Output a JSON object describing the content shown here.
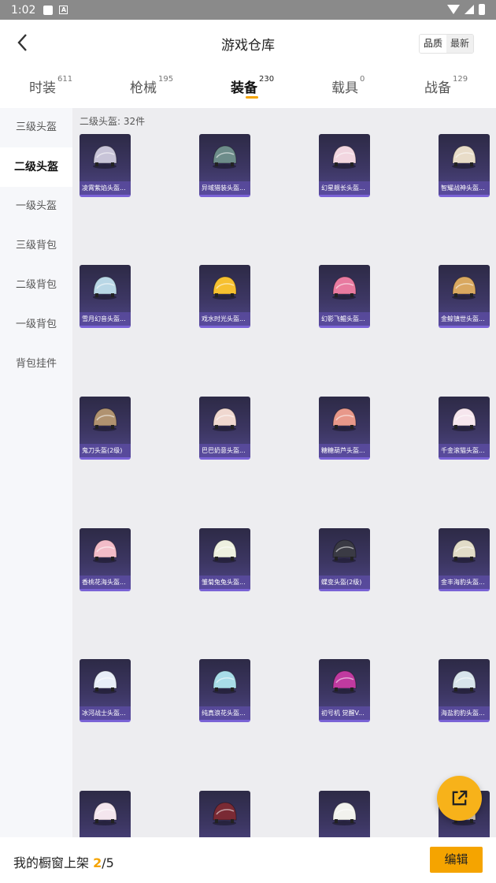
{
  "status_bar": {
    "time": "1:02"
  },
  "header": {
    "title": "游戏仓库",
    "sort_quality": "品质",
    "sort_latest": "最新"
  },
  "tabs": [
    {
      "label": "时装",
      "count": "611"
    },
    {
      "label": "枪械",
      "count": "195"
    },
    {
      "label": "装备",
      "count": "230"
    },
    {
      "label": "载具",
      "count": "0"
    },
    {
      "label": "战备",
      "count": "129"
    }
  ],
  "sidebar": {
    "items": [
      {
        "label": "三级头盔"
      },
      {
        "label": "二级头盔"
      },
      {
        "label": "一级头盔"
      },
      {
        "label": "三级背包"
      },
      {
        "label": "二级背包"
      },
      {
        "label": "一级背包"
      },
      {
        "label": "背包挂件"
      }
    ]
  },
  "main": {
    "count_label": "二级头盔: 32件",
    "items": [
      {
        "label": "凌霄紫焰头盔...",
        "color": "#c8c4d8"
      },
      {
        "label": "异域猎装头盔...",
        "color": "#6d8c8a"
      },
      {
        "label": "幻星舰长头盔...",
        "color": "#f2d6e0"
      },
      {
        "label": "智耀战神头盔...",
        "color": "#e8dcc8"
      },
      {
        "label": "雪月幻音头盔...",
        "color": "#b9d7e6"
      },
      {
        "label": "戏水时光头盔...",
        "color": "#f6c030"
      },
      {
        "label": "幻影飞鲲头盔...",
        "color": "#e87aa0"
      },
      {
        "label": "金鲸镇世头盔...",
        "color": "#d9a860"
      },
      {
        "label": "鬼刀头盔(2级)",
        "color": "#b09270"
      },
      {
        "label": "巴巴奶意头盔...",
        "color": "#f0d8d0"
      },
      {
        "label": "糖糖葫芦头盔...",
        "color": "#e8988a"
      },
      {
        "label": "千金滚猫头盔...",
        "color": "#f6e6ee"
      },
      {
        "label": "香桃花海头盔...",
        "color": "#f2bcc8"
      },
      {
        "label": "雏菊兔兔头盔...",
        "color": "#eef0e0"
      },
      {
        "label": "蝶变头盔(2级)",
        "color": "#3a3a44"
      },
      {
        "label": "金丰海豹头盔...",
        "color": "#e2dcc8"
      },
      {
        "label": "冰河战士头盔...",
        "color": "#e8eef8"
      },
      {
        "label": "纯真浪花头盔...",
        "color": "#a8dce8"
      },
      {
        "label": "初号机 觉醒V...",
        "color": "#c03aa0"
      },
      {
        "label": "海盐豹豹头盔...",
        "color": "#d8e4ec"
      },
      {
        "label": "",
        "color": "#f4e6ee"
      },
      {
        "label": "",
        "color": "#7a2a34"
      },
      {
        "label": "",
        "color": "#f2f2ee"
      },
      {
        "label": "",
        "color": "#e0d0c0"
      }
    ]
  },
  "bottom_bar": {
    "shelf_label": "我的橱窗上架",
    "shelf_current": "2",
    "shelf_separator": "/",
    "shelf_total": "5",
    "edit_label": "编辑"
  },
  "colors": {
    "accent": "#f5a400",
    "card_bottom": "#7a63d6"
  }
}
